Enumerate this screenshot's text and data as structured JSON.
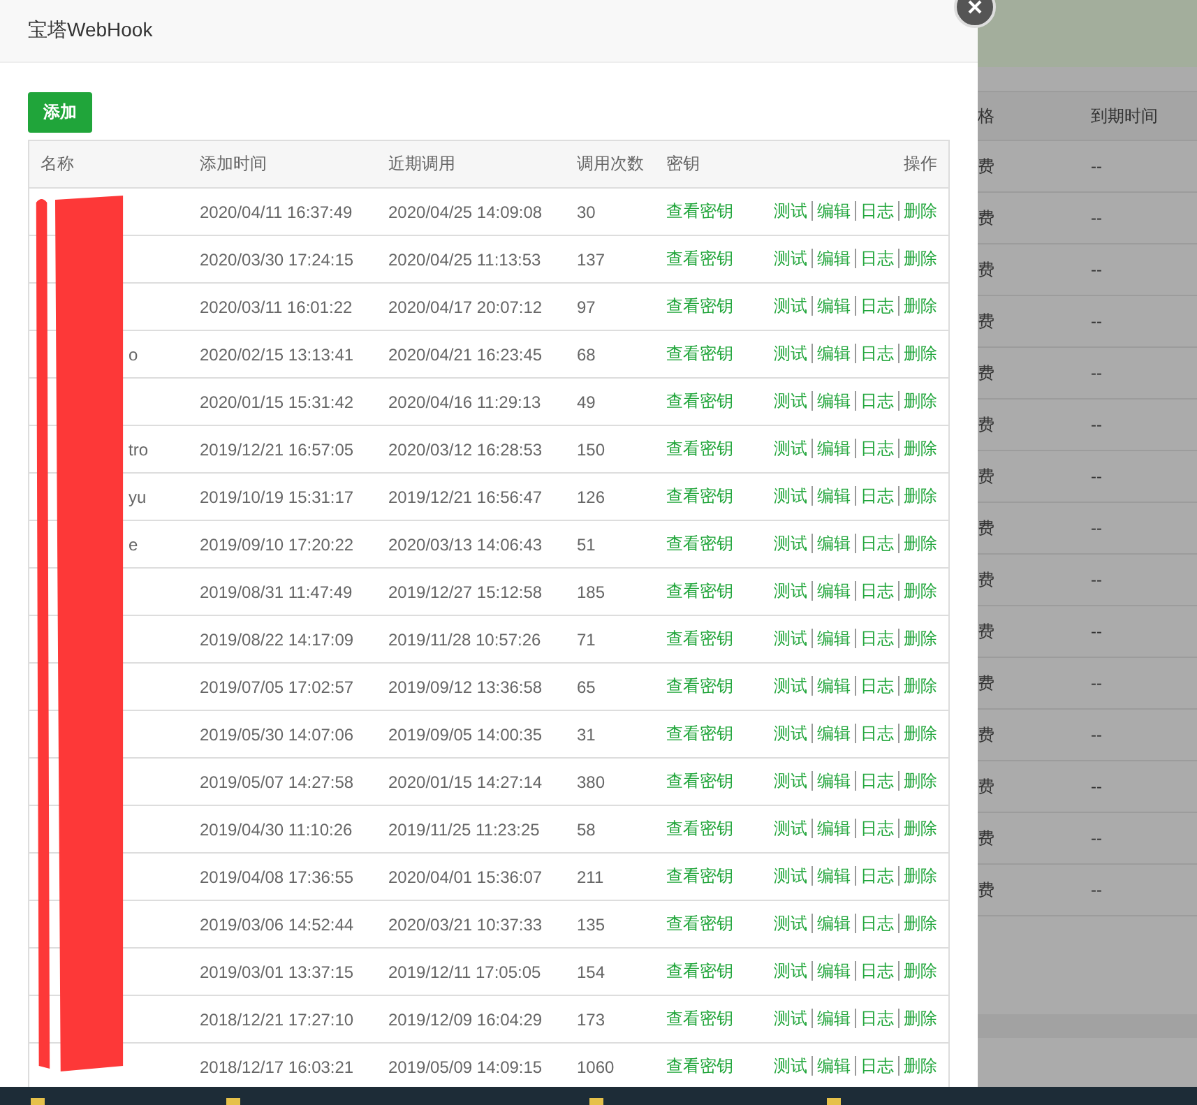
{
  "background_page": {
    "columns": [
      "格",
      "到期时间"
    ],
    "rows": [
      {
        "column_1": "费",
        "column_2": "--"
      },
      {
        "column_1": "费",
        "column_2": "--"
      },
      {
        "column_1": "费",
        "column_2": "--"
      },
      {
        "column_1": "费",
        "column_2": "--"
      },
      {
        "column_1": "费",
        "column_2": "--"
      },
      {
        "column_1": "费",
        "column_2": "--"
      },
      {
        "column_1": "费",
        "column_2": "--"
      },
      {
        "column_1": "费",
        "column_2": "--"
      },
      {
        "column_1": "费",
        "column_2": "--"
      },
      {
        "column_1": "费",
        "column_2": "--"
      },
      {
        "column_1": "费",
        "column_2": "--"
      },
      {
        "column_1": "费",
        "column_2": "--"
      },
      {
        "column_1": "费",
        "column_2": "--"
      },
      {
        "column_1": "费",
        "column_2": "--"
      },
      {
        "column_1": "费",
        "column_2": "--"
      }
    ]
  },
  "dialog": {
    "title": "宝塔WebHook",
    "add_button": "添加",
    "table": {
      "columns": [
        "名称",
        "添加时间",
        "近期调用",
        "调用次数",
        "密钥",
        "操作"
      ],
      "rows": [
        {
          "added": "2020/04/11 16:37:49",
          "last_call": "2020/04/25 14:09:08",
          "calls": "30",
          "key": "查看密钥",
          "actions": [
            "测试",
            "编辑",
            "日志",
            "删除"
          ]
        },
        {
          "added": "2020/03/30 17:24:15",
          "last_call": "2020/04/25 11:13:53",
          "calls": "137",
          "key": "查看密钥",
          "actions": [
            "测试",
            "编辑",
            "日志",
            "删除"
          ]
        },
        {
          "added": "2020/03/11 16:01:22",
          "last_call": "2020/04/17 20:07:12",
          "calls": "97",
          "key": "查看密钥",
          "actions": [
            "测试",
            "编辑",
            "日志",
            "删除"
          ]
        },
        {
          "name": "o",
          "added": "2020/02/15 13:13:41",
          "last_call": "2020/04/21 16:23:45",
          "calls": "68",
          "key": "查看密钥",
          "actions": [
            "测试",
            "编辑",
            "日志",
            "删除"
          ]
        },
        {
          "added": "2020/01/15 15:31:42",
          "last_call": "2020/04/16 11:29:13",
          "calls": "49",
          "key": "查看密钥",
          "actions": [
            "测试",
            "编辑",
            "日志",
            "删除"
          ]
        },
        {
          "name": "tro",
          "added": "2019/12/21 16:57:05",
          "last_call": "2020/03/12 16:28:53",
          "calls": "150",
          "key": "查看密钥",
          "actions": [
            "测试",
            "编辑",
            "日志",
            "删除"
          ]
        },
        {
          "name": "yu",
          "added": "2019/10/19 15:31:17",
          "last_call": "2019/12/21 16:56:47",
          "calls": "126",
          "key": "查看密钥",
          "actions": [
            "测试",
            "编辑",
            "日志",
            "删除"
          ]
        },
        {
          "name": "e",
          "added": "2019/09/10 17:20:22",
          "last_call": "2020/03/13 14:06:43",
          "calls": "51",
          "key": "查看密钥",
          "actions": [
            "测试",
            "编辑",
            "日志",
            "删除"
          ]
        },
        {
          "added": "2019/08/31 11:47:49",
          "last_call": "2019/12/27 15:12:58",
          "calls": "185",
          "key": "查看密钥",
          "actions": [
            "测试",
            "编辑",
            "日志",
            "删除"
          ]
        },
        {
          "added": "2019/08/22 14:17:09",
          "last_call": "2019/11/28 10:57:26",
          "calls": "71",
          "key": "查看密钥",
          "actions": [
            "测试",
            "编辑",
            "日志",
            "删除"
          ]
        },
        {
          "added": "2019/07/05 17:02:57",
          "last_call": "2019/09/12 13:36:58",
          "calls": "65",
          "key": "查看密钥",
          "actions": [
            "测试",
            "编辑",
            "日志",
            "删除"
          ]
        },
        {
          "added": "2019/05/30 14:07:06",
          "last_call": "2019/09/05 14:00:35",
          "calls": "31",
          "key": "查看密钥",
          "actions": [
            "测试",
            "编辑",
            "日志",
            "删除"
          ]
        },
        {
          "added": "2019/05/07 14:27:58",
          "last_call": "2020/01/15 14:27:14",
          "calls": "380",
          "key": "查看密钥",
          "actions": [
            "测试",
            "编辑",
            "日志",
            "删除"
          ]
        },
        {
          "added": "2019/04/30 11:10:26",
          "last_call": "2019/11/25 11:23:25",
          "calls": "58",
          "key": "查看密钥",
          "actions": [
            "测试",
            "编辑",
            "日志",
            "删除"
          ]
        },
        {
          "added": "2019/04/08 17:36:55",
          "last_call": "2020/04/01 15:36:07",
          "calls": "211",
          "key": "查看密钥",
          "actions": [
            "测试",
            "编辑",
            "日志",
            "删除"
          ]
        },
        {
          "added": "2019/03/06 14:52:44",
          "last_call": "2020/03/21 10:37:33",
          "calls": "135",
          "key": "查看密钥",
          "actions": [
            "测试",
            "编辑",
            "日志",
            "删除"
          ]
        },
        {
          "added": "2019/03/01 13:37:15",
          "last_call": "2019/12/11 17:05:05",
          "calls": "154",
          "key": "查看密钥",
          "actions": [
            "测试",
            "编辑",
            "日志",
            "删除"
          ]
        },
        {
          "added": "2018/12/21 17:27:10",
          "last_call": "2019/12/09 16:04:29",
          "calls": "173",
          "key": "查看密钥",
          "actions": [
            "测试",
            "编辑",
            "日志",
            "删除"
          ]
        },
        {
          "added": "2018/12/17 16:03:21",
          "last_call": "2019/05/09 14:09:15",
          "calls": "1060",
          "key": "查看密钥",
          "actions": [
            "测试",
            "编辑",
            "日志",
            "删除"
          ]
        }
      ]
    }
  }
}
